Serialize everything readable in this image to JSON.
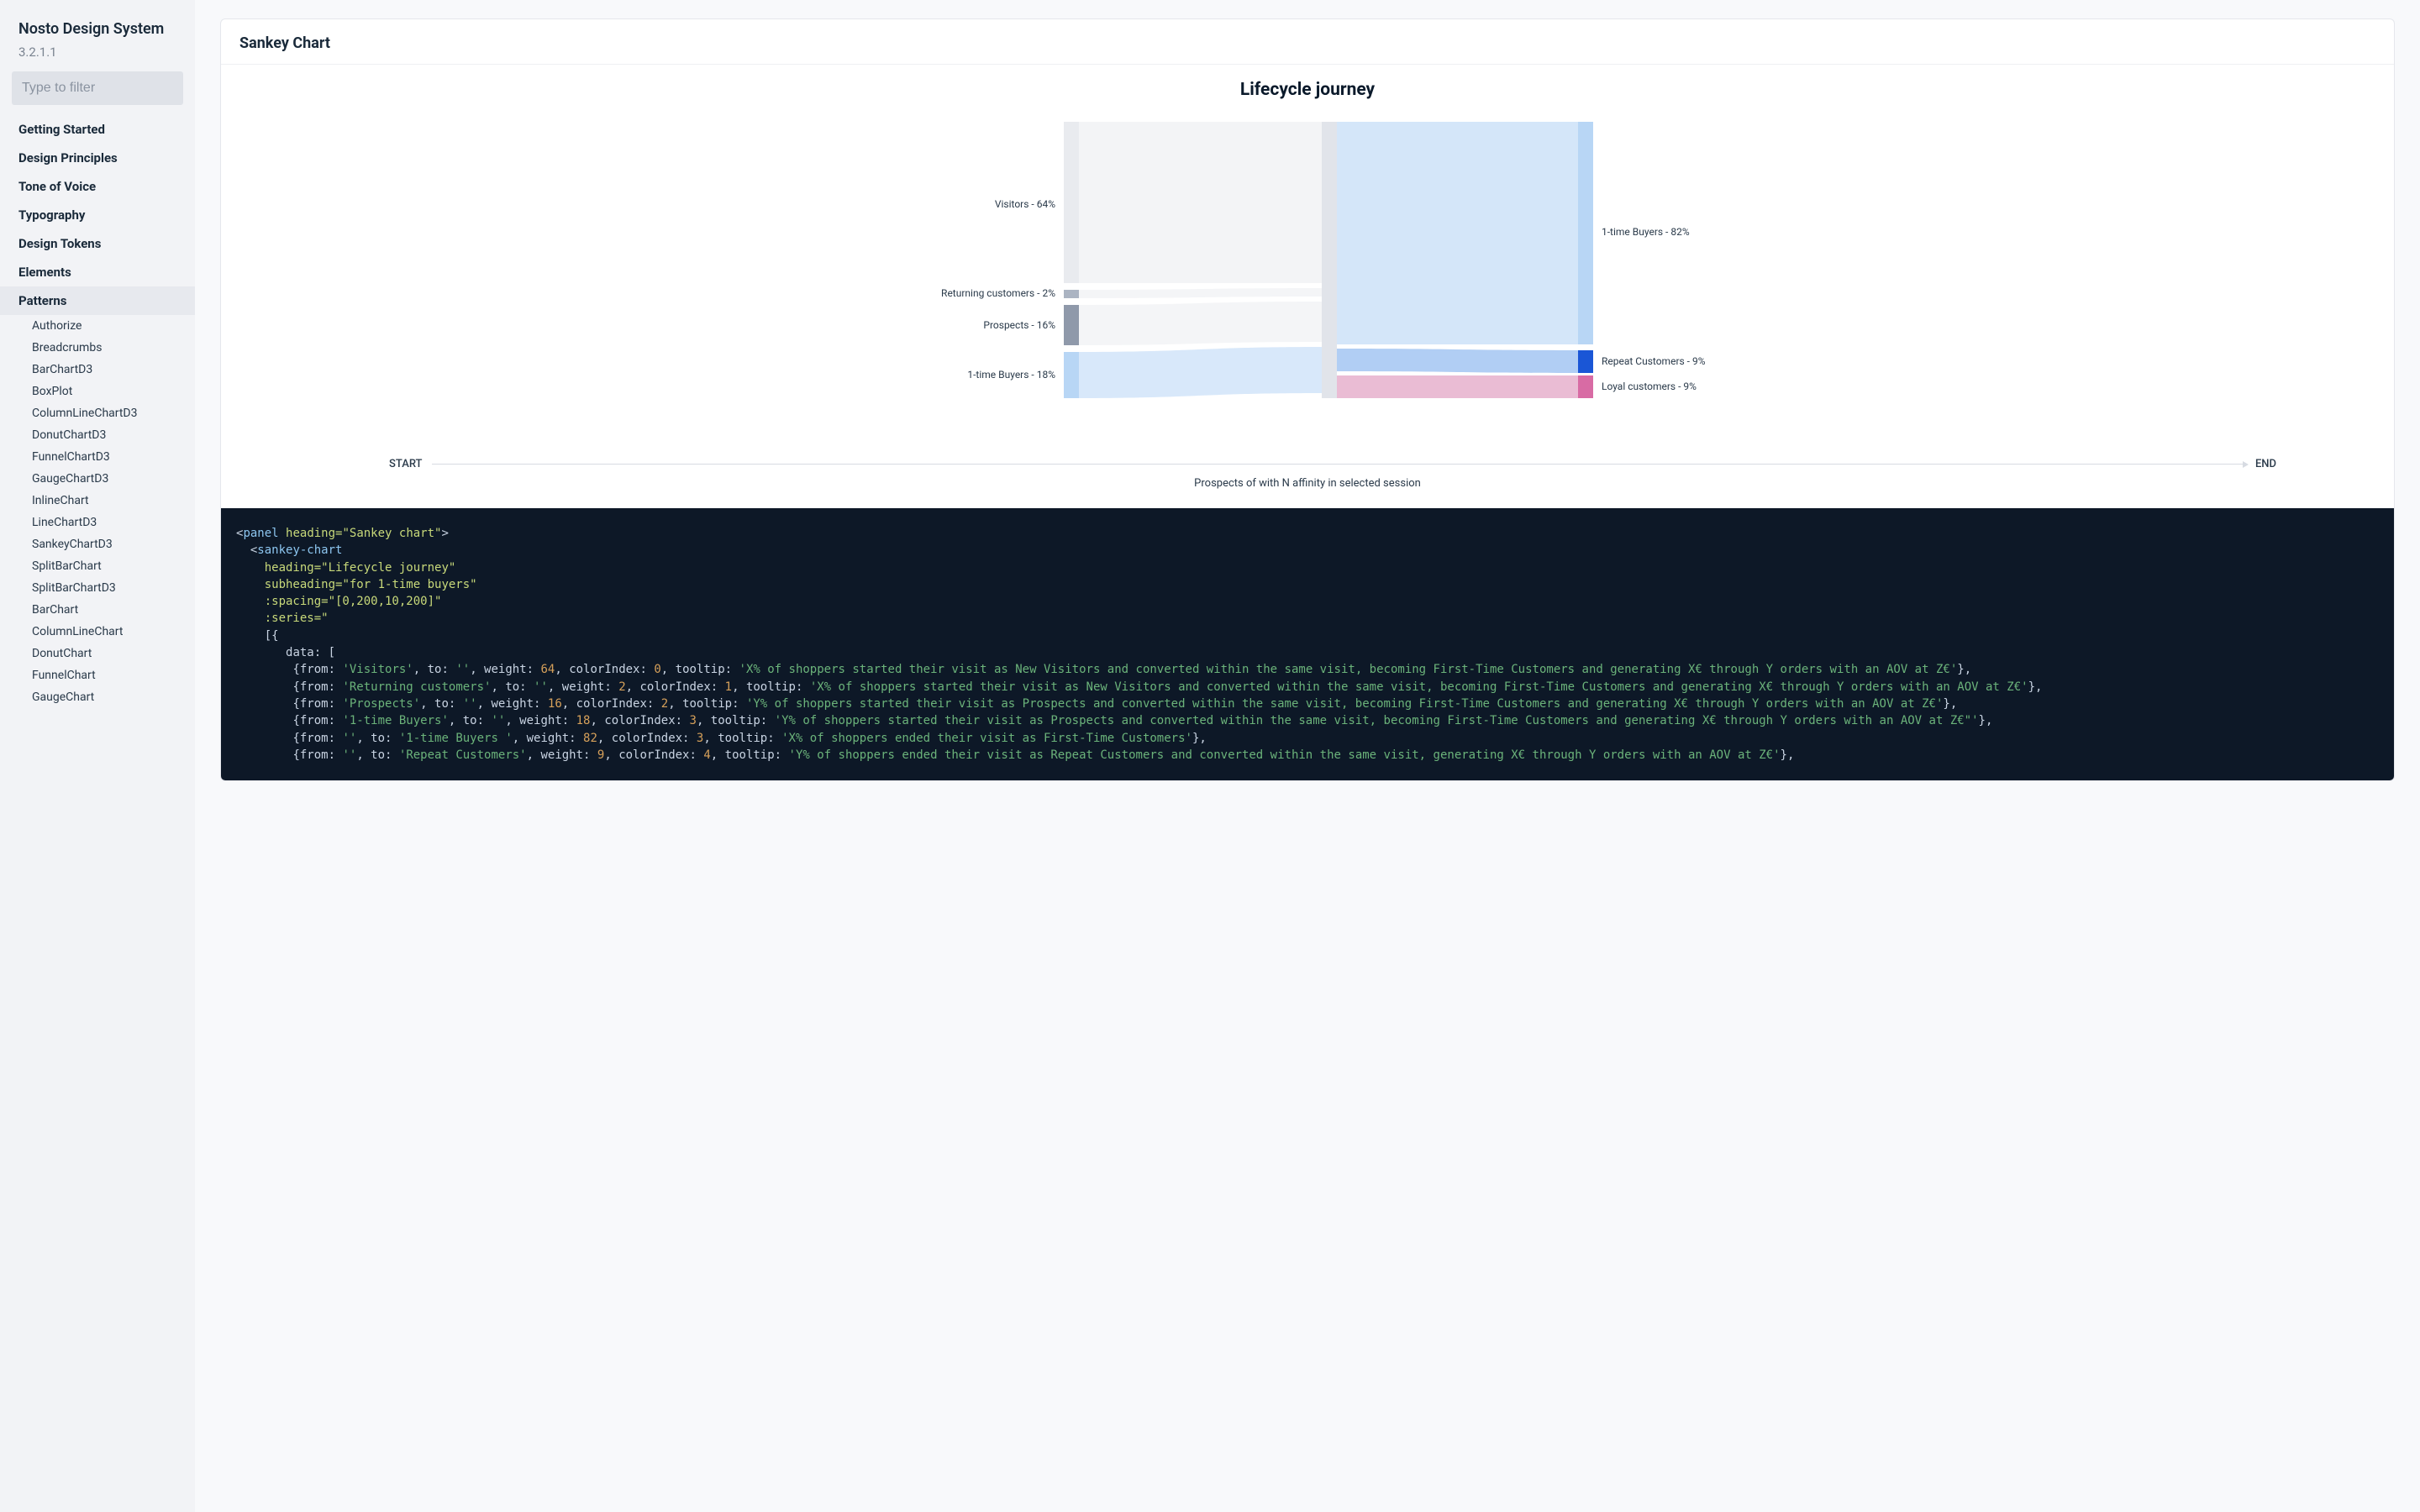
{
  "sidebar": {
    "title": "Nosto Design System",
    "version": "3.2.1.1",
    "search_placeholder": "Type to filter",
    "items": [
      {
        "label": "Getting Started",
        "active": false
      },
      {
        "label": "Design Principles",
        "active": false
      },
      {
        "label": "Tone of Voice",
        "active": false
      },
      {
        "label": "Typography",
        "active": false
      },
      {
        "label": "Design Tokens",
        "active": false
      },
      {
        "label": "Elements",
        "active": false
      },
      {
        "label": "Patterns",
        "active": true
      }
    ],
    "subitems": [
      "Authorize",
      "Breadcrumbs",
      "BarChartD3",
      "BoxPlot",
      "ColumnLineChartD3",
      "DonutChartD3",
      "FunnelChartD3",
      "GaugeChartD3",
      "InlineChart",
      "LineChartD3",
      "SankeyChartD3",
      "SplitBarChart",
      "SplitBarChartD3",
      "BarChart",
      "ColumnLineChart",
      "DonutChart",
      "FunnelChart",
      "GaugeChart"
    ]
  },
  "panel": {
    "heading": "Sankey Chart"
  },
  "chart": {
    "title": "Lifecycle journey",
    "axis_start": "START",
    "axis_end": "END",
    "axis_sub": "Prospects of with N affinity in selected session",
    "labels": {
      "visitors": "Visitors - 64%",
      "returning": "Returning customers - 2%",
      "prospects": "Prospects - 16%",
      "onebuyers_l": "1-time Buyers - 18%",
      "onebuyers_r": "1-time Buyers - 82%",
      "repeat": "Repeat Customers - 9%",
      "loyal": "Loyal customers - 9%"
    }
  },
  "chart_data": {
    "type": "sankey",
    "title": "Lifecycle journey",
    "left_nodes": [
      {
        "name": "Visitors",
        "value_pct": 64
      },
      {
        "name": "Returning customers",
        "value_pct": 2
      },
      {
        "name": "Prospects",
        "value_pct": 16
      },
      {
        "name": "1-time Buyers",
        "value_pct": 18
      }
    ],
    "right_nodes": [
      {
        "name": "1-time Buyers",
        "value_pct": 82
      },
      {
        "name": "Repeat Customers",
        "value_pct": 9
      },
      {
        "name": "Loyal customers",
        "value_pct": 9
      }
    ],
    "links": [
      {
        "from": "Visitors",
        "to": "",
        "weight": 64,
        "colorIndex": 0
      },
      {
        "from": "Returning customers",
        "to": "",
        "weight": 2,
        "colorIndex": 1
      },
      {
        "from": "Prospects",
        "to": "",
        "weight": 16,
        "colorIndex": 2
      },
      {
        "from": "1-time Buyers",
        "to": "",
        "weight": 18,
        "colorIndex": 3
      },
      {
        "from": "",
        "to": "1-time Buyers ",
        "weight": 82,
        "colorIndex": 3
      },
      {
        "from": "",
        "to": "Repeat Customers",
        "weight": 9,
        "colorIndex": 4
      },
      {
        "from": "",
        "to": "Loyal customers",
        "weight": 9
      }
    ],
    "axis": {
      "start": "START",
      "end": "END",
      "subheading": "Prospects of with N affinity in selected session"
    },
    "colors": {
      "0": "#e9ebef",
      "1": "#abb4c2",
      "2": "#8f99aa",
      "3": "#b8d6f5",
      "4": "#1a56d6",
      "5": "#d86ba4"
    }
  },
  "code": {
    "l1_tag": "panel",
    "l1_attr": "heading=",
    "l1_val": "\"Sankey chart\"",
    "l2_tag": "sankey-chart",
    "l3_attr": "heading=",
    "l3_val": "\"Lifecycle journey\"",
    "l4_attr": "subheading=",
    "l4_val": "\"for 1-time buyers\"",
    "l5_attr": ":spacing=",
    "l5_val": "\"[0,200,10,200]\"",
    "l6_attr": ":series=",
    "l6_val": "\"",
    "l7": "[{",
    "l8": "data: [",
    "flow1_a": "{from: ",
    "flow1_from": "'Visitors'",
    "flow1_b": ", to: ",
    "flow1_to": "''",
    "flow1_c": ", weight: ",
    "flow1_w": "64",
    "flow1_d": ", colorIndex: ",
    "flow1_ci": "0",
    "flow1_e": ", tooltip: ",
    "flow1_tt": "'X% of shoppers started their visit as New Visitors and converted within the same visit, becoming First-Time Customers and generating X€ through Y orders with an AOV at Z€'",
    "flow1_f": "},",
    "flow2_a": "{from: ",
    "flow2_from": "'Returning customers'",
    "flow2_b": ", to: ",
    "flow2_to": "''",
    "flow2_c": ", weight: ",
    "flow2_w": "2",
    "flow2_d": ", colorIndex: ",
    "flow2_ci": "1",
    "flow2_e": ", tooltip: ",
    "flow2_tt": "'X% of shoppers started their visit as New Visitors and converted within the same visit, becoming First-Time Customers and generating X€ through Y orders with an AOV at Z€'",
    "flow2_f": "},",
    "flow3_a": "{from: ",
    "flow3_from": "'Prospects'",
    "flow3_b": ", to: ",
    "flow3_to": "''",
    "flow3_c": ", weight: ",
    "flow3_w": "16",
    "flow3_d": ", colorIndex: ",
    "flow3_ci": "2",
    "flow3_e": ", tooltip: ",
    "flow3_tt": "'Y% of shoppers started their visit as Prospects and converted within the same visit, becoming First-Time Customers and generating X€ through Y orders with an AOV at Z€'",
    "flow3_f": "},",
    "flow4_a": "{from: ",
    "flow4_from": "'1-time Buyers'",
    "flow4_b": ", to: ",
    "flow4_to": "''",
    "flow4_c": ", weight: ",
    "flow4_w": "18",
    "flow4_d": ", colorIndex: ",
    "flow4_ci": "3",
    "flow4_e": ", tooltip: ",
    "flow4_tt": "'Y% of shoppers started their visit as Prospects and converted within the same visit, becoming First-Time Customers and generating X€ through Y orders with an AOV at Z€\"'",
    "flow4_f": "},",
    "flow5_a": "{from: ",
    "flow5_from": "''",
    "flow5_b": ", to: ",
    "flow5_to": "'1-time Buyers '",
    "flow5_c": ", weight: ",
    "flow5_w": "82",
    "flow5_d": ", colorIndex: ",
    "flow5_ci": "3",
    "flow5_e": ", tooltip: ",
    "flow5_tt": "'X% of shoppers ended their visit as First-Time Customers'",
    "flow5_f": "},",
    "flow6_a": "{from: ",
    "flow6_from": "''",
    "flow6_b": ", to: ",
    "flow6_to": "'Repeat Customers'",
    "flow6_c": ", weight: ",
    "flow6_w": "9",
    "flow6_d": ", colorIndex: ",
    "flow6_ci": "4",
    "flow6_e": ", tooltip: ",
    "flow6_tt": "'Y% of shoppers ended their visit as Repeat Customers and converted within the same visit, generating X€ through Y orders with an AOV at Z€'",
    "flow6_f": "},"
  }
}
